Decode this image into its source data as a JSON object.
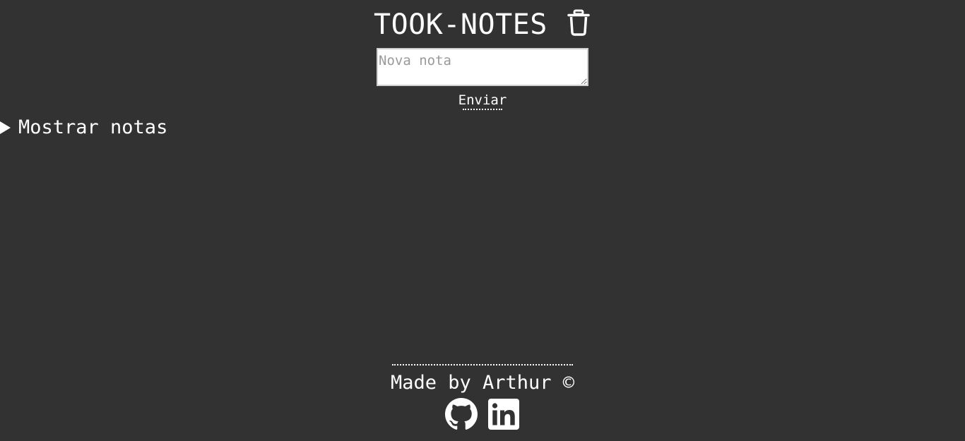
{
  "header": {
    "title": "TOOK-NOTES",
    "clear_icon": "trash-icon"
  },
  "composer": {
    "placeholder": "Nova nota",
    "value": "",
    "submit_label": "Enviar"
  },
  "notes_panel": {
    "toggle_label": "Mostrar notas",
    "expanded": false,
    "toggle_icon": "triangle-right-icon"
  },
  "footer": {
    "credit": "Made by Arthur ©",
    "links": [
      {
        "icon": "github-icon"
      },
      {
        "icon": "linkedin-icon"
      }
    ]
  },
  "colors": {
    "background": "#323232",
    "foreground": "#ffffff",
    "input_background": "#ffffff",
    "placeholder": "#9a9a9a"
  }
}
